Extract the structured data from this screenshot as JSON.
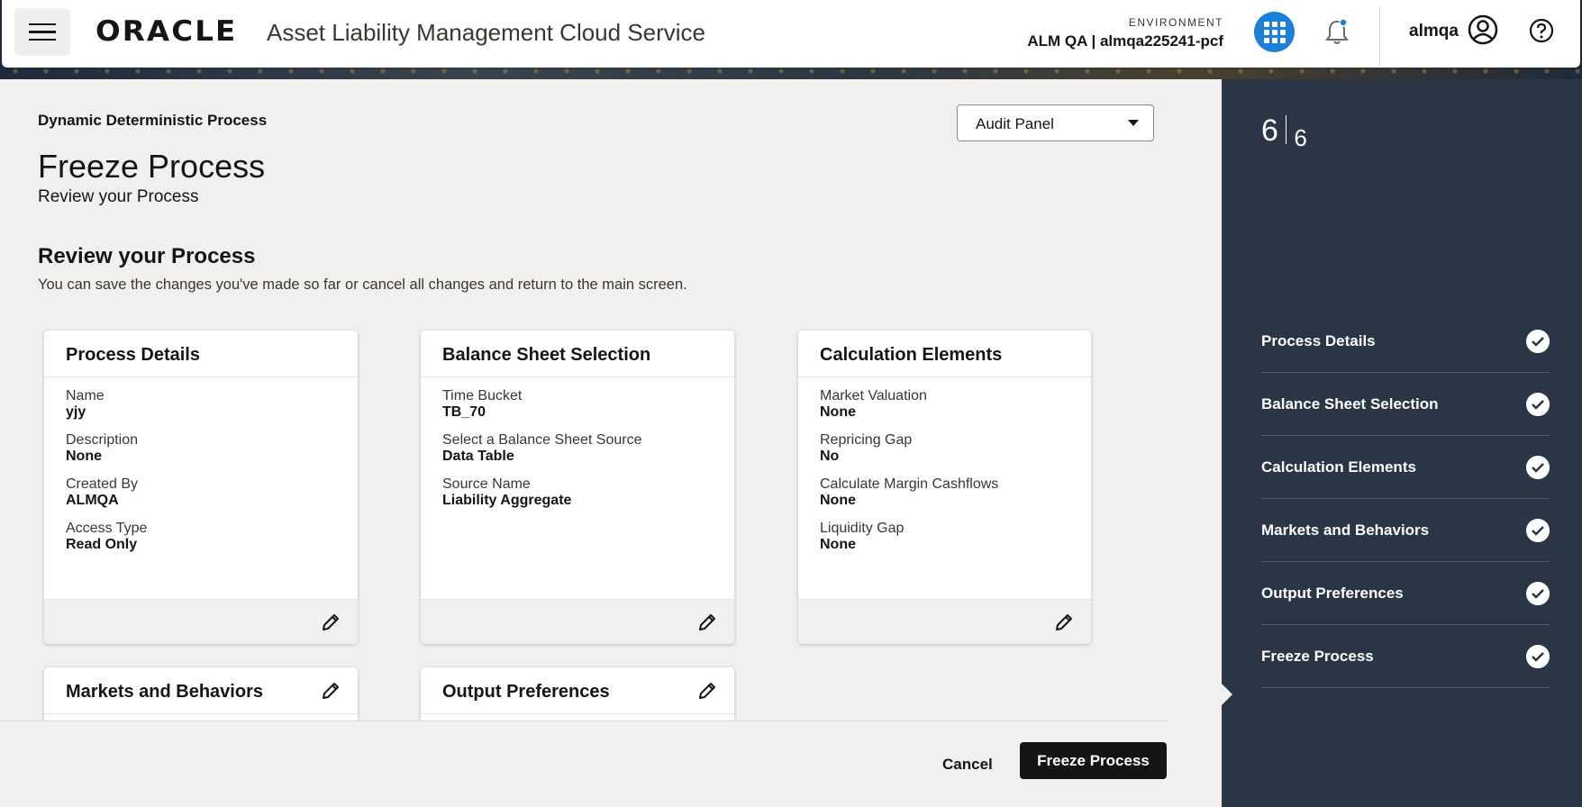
{
  "header": {
    "logo_text": "ORACLE",
    "app_title": "Asset Liability Management Cloud Service",
    "environment_label": "ENVIRONMENT",
    "environment_value": "ALM QA | almqa225241-pcf",
    "user_name": "almqa",
    "icons": [
      "hamburger-menu-icon",
      "apps-grid-icon",
      "notification-bell-icon",
      "user-avatar-icon",
      "help-icon"
    ],
    "accent_color": "#1a7fd6"
  },
  "main": {
    "process_type": "Dynamic Deterministic Process",
    "audit_panel": {
      "selected": "Audit Panel"
    },
    "page_title": "Freeze Process",
    "page_subtitle": "Review your Process",
    "section_title": "Review your Process",
    "section_desc": "You can save the changes you've made so far or cancel all changes and return to the main screen.",
    "cards": [
      {
        "title": "Process Details",
        "fields": [
          {
            "label": "Name",
            "value": "yjy"
          },
          {
            "label": "Description",
            "value": "None"
          },
          {
            "label": "Created By",
            "value": "ALMQA"
          },
          {
            "label": "Access Type",
            "value": "Read Only"
          }
        ]
      },
      {
        "title": "Balance Sheet Selection",
        "fields": [
          {
            "label": "Time Bucket",
            "value": "TB_70"
          },
          {
            "label": "Select a Balance Sheet Source",
            "value": "Data Table"
          },
          {
            "label": "Source Name",
            "value": "Liability Aggregate"
          }
        ]
      },
      {
        "title": "Calculation Elements",
        "fields": [
          {
            "label": "Market Valuation",
            "value": "None"
          },
          {
            "label": "Repricing Gap",
            "value": "No"
          },
          {
            "label": "Calculate Margin Cashflows",
            "value": "None"
          },
          {
            "label": "Liquidity Gap",
            "value": "None"
          }
        ]
      },
      {
        "title": "Markets and Behaviors"
      },
      {
        "title": "Output Preferences"
      }
    ],
    "cancel_label": "Cancel",
    "freeze_label": "Freeze Process"
  },
  "train": {
    "current": "6",
    "total": "6",
    "steps": [
      "Process Details",
      "Balance Sheet Selection",
      "Calculation Elements",
      "Markets and Behaviors",
      "Output Preferences",
      "Freeze Process"
    ]
  }
}
